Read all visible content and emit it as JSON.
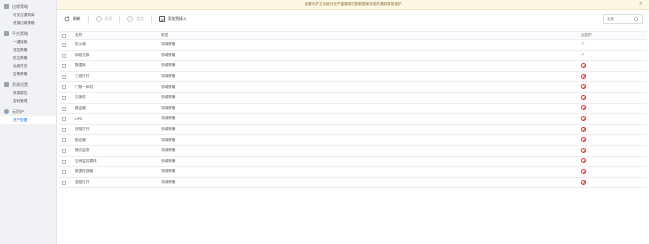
{
  "sidebar": {
    "groups": [
      {
        "label": "边缘策略",
        "icon": "strategy-icon",
        "items": [
          "可关注漏洞库",
          "资源边缘策略"
        ]
      },
      {
        "label": "平台策略",
        "icon": "platform-icon",
        "items": [
          "一键接管",
          "流控策略",
          "防注策略",
          "运维任务",
          "告警策略"
        ]
      },
      {
        "label": "资源设置",
        "icon": "settings-icon",
        "items": [
          "资源属性",
          "密码管理"
        ]
      },
      {
        "label": "云防护",
        "icon": "cloud-icon",
        "items": [
          "资产配置"
        ]
      }
    ],
    "active_item": "资产配置"
  },
  "banner": {
    "text": "设置中护卫功能仍在严重漏洞匹配数据库完成的漏洞类型保护",
    "close": "×"
  },
  "toolbar": {
    "refresh": "刷新",
    "enable": "启用",
    "disable": "禁用",
    "import": "添加到接入",
    "search_placeholder": "名称"
  },
  "table": {
    "headers": {
      "name": "名称",
      "type": "类型",
      "monitor": "云防护"
    },
    "rows": [
      {
        "name": "防火墙",
        "type": "领域策略",
        "status": "on"
      },
      {
        "name": "网络交换",
        "type": "领域策略",
        "status": "on"
      },
      {
        "name": "数据库",
        "type": "领域策略",
        "status": "off"
      },
      {
        "name": "三维打开",
        "type": "领域策略",
        "status": "off"
      },
      {
        "name": "门禁一体机",
        "type": "领域策略",
        "status": "off"
      },
      {
        "name": "交换机",
        "type": "领域策略",
        "status": "off"
      },
      {
        "name": "路由器",
        "type": "领域策略",
        "status": "off"
      },
      {
        "name": "UPS",
        "type": "领域策略",
        "status": "off"
      },
      {
        "name": "双相打开",
        "type": "领域策略",
        "status": "off"
      },
      {
        "name": "配合器",
        "type": "领域策略",
        "status": "off"
      },
      {
        "name": "微光监测",
        "type": "领域策略",
        "status": "off"
      },
      {
        "name": "空间监控模块",
        "type": "领域策略",
        "status": "off"
      },
      {
        "name": "数据传感器",
        "type": "领域策略",
        "status": "off"
      },
      {
        "name": "温相打开",
        "type": "领域策略",
        "status": "off"
      }
    ]
  },
  "colors": {
    "enabled": "#3bb54a",
    "disabled": "#e0393e",
    "active": "#1677ff"
  }
}
